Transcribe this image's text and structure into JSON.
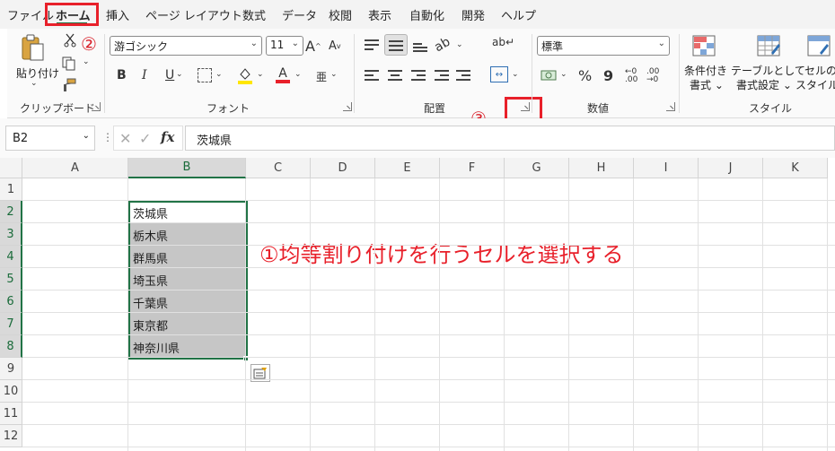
{
  "menu": {
    "file": "ファイル",
    "home": "ホーム",
    "insert": "挿入",
    "page_layout": "ページ レイアウト",
    "formulas": "数式",
    "data": "データ",
    "review": "校閲",
    "view": "表示",
    "automate": "自動化",
    "developer": "開発",
    "help": "ヘルプ"
  },
  "ribbon": {
    "clipboard": {
      "paste_label": "貼り付け",
      "group_label": "クリップボード"
    },
    "font": {
      "font_name": "游ゴシック",
      "font_size": "11",
      "bold": "B",
      "italic": "I",
      "underline": "U",
      "grow": "A",
      "shrink": "A",
      "font_color": "A",
      "phonetic": "亜",
      "group_label": "フォント"
    },
    "alignment": {
      "group_label": "配置"
    },
    "number": {
      "format": "標準",
      "percent": "%",
      "comma": "9",
      "group_label": "数値"
    },
    "styles": {
      "conditional_label_1": "条件付き",
      "conditional_label_2": "書式",
      "table_label_1": "テーブルとして",
      "table_label_2": "書式設定",
      "cell_label_1": "セルの",
      "cell_label_2": "スタイル",
      "group_label": "スタイル"
    }
  },
  "annotations": {
    "step1": "①均等割り付けを行うセルを選択する",
    "step2": "②",
    "step3": "③"
  },
  "formula_bar": {
    "name_box": "B2",
    "fx": "fx",
    "content": "茨城県"
  },
  "sheet": {
    "columns": [
      "A",
      "B",
      "C",
      "D",
      "E",
      "F",
      "G",
      "H",
      "I",
      "J",
      "K"
    ],
    "rows": [
      "1",
      "2",
      "3",
      "4",
      "5",
      "6",
      "7",
      "8",
      "9",
      "10",
      "11",
      "12"
    ],
    "b_cells": [
      "茨城県",
      "栃木県",
      "群馬県",
      "埼玉県",
      "千葉県",
      "東京都",
      "神奈川県"
    ]
  },
  "colors": {
    "accent": "#217346",
    "annotation": "#e8202a",
    "selection_fill": "#c6c6c6"
  }
}
